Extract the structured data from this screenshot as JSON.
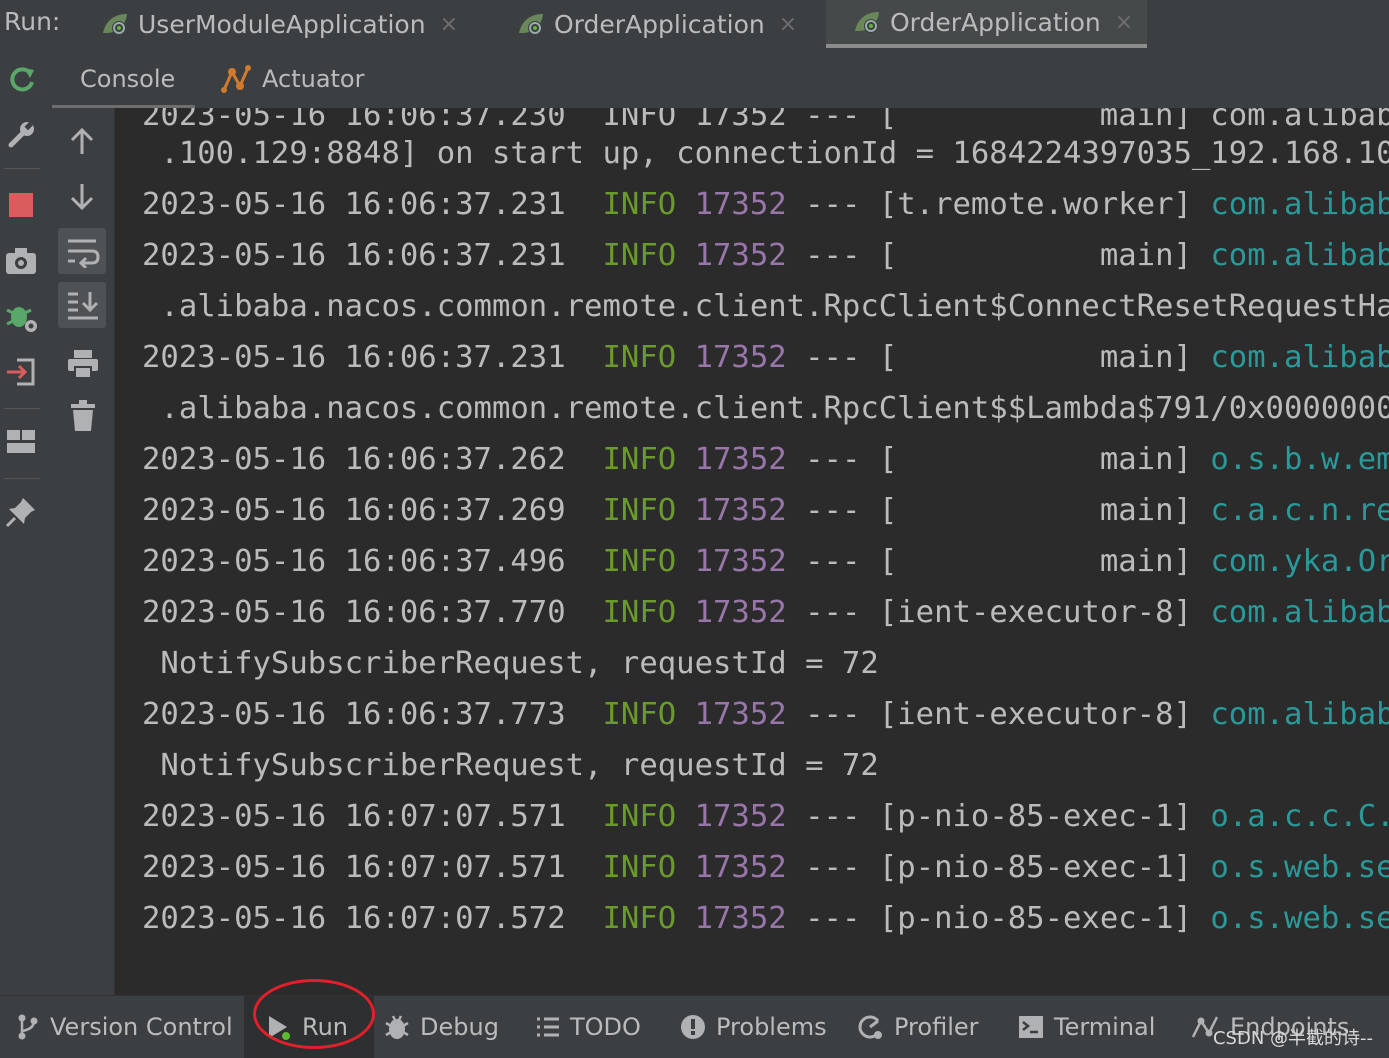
{
  "run_bar": {
    "label": "Run:",
    "tabs": [
      {
        "label": "UserModuleApplication",
        "close": "×"
      },
      {
        "label": "OrderApplication",
        "close": "×"
      },
      {
        "label": "OrderApplication",
        "close": "×"
      }
    ]
  },
  "sub_tabs": {
    "console": "Console",
    "actuator": "Actuator"
  },
  "console": {
    "lines": [
      {
        "type": "cont",
        "text": "2023-05-16 16:06:37.230  INFO 17352 --- [           main] com.alibab"
      },
      {
        "type": "cont",
        "text": " .100.129:8848] on start up, connectionId = 1684224397035_192.168.10"
      },
      {
        "type": "log",
        "ts": "2023-05-16 16:06:37.231",
        "level": "INFO",
        "pid": "17352",
        "sep": "---",
        "thread": "[t.remote.worker]",
        "logger": "com.alibab"
      },
      {
        "type": "log",
        "ts": "2023-05-16 16:06:37.231",
        "level": "INFO",
        "pid": "17352",
        "sep": "---",
        "thread": "[           main]",
        "logger": "com.alibab"
      },
      {
        "type": "cont",
        "text": " .alibaba.nacos.common.remote.client.RpcClient$ConnectResetRequestHa"
      },
      {
        "type": "log",
        "ts": "2023-05-16 16:06:37.231",
        "level": "INFO",
        "pid": "17352",
        "sep": "---",
        "thread": "[           main]",
        "logger": "com.alibab"
      },
      {
        "type": "cont",
        "text": " .alibaba.nacos.common.remote.client.RpcClient$$Lambda$791/0x0000000"
      },
      {
        "type": "log",
        "ts": "2023-05-16 16:06:37.262",
        "level": "INFO",
        "pid": "17352",
        "sep": "---",
        "thread": "[           main]",
        "logger": "o.s.b.w.em"
      },
      {
        "type": "log",
        "ts": "2023-05-16 16:06:37.269",
        "level": "INFO",
        "pid": "17352",
        "sep": "---",
        "thread": "[           main]",
        "logger": "c.a.c.n.re"
      },
      {
        "type": "log",
        "ts": "2023-05-16 16:06:37.496",
        "level": "INFO",
        "pid": "17352",
        "sep": "---",
        "thread": "[           main]",
        "logger": "com.yka.Or"
      },
      {
        "type": "log",
        "ts": "2023-05-16 16:06:37.770",
        "level": "INFO",
        "pid": "17352",
        "sep": "---",
        "thread": "[ient-executor-8]",
        "logger": "com.alibab"
      },
      {
        "type": "cont",
        "text": " NotifySubscriberRequest, requestId = 72"
      },
      {
        "type": "log",
        "ts": "2023-05-16 16:06:37.773",
        "level": "INFO",
        "pid": "17352",
        "sep": "---",
        "thread": "[ient-executor-8]",
        "logger": "com.alibab"
      },
      {
        "type": "cont",
        "text": " NotifySubscriberRequest, requestId = 72"
      },
      {
        "type": "log",
        "ts": "2023-05-16 16:07:07.571",
        "level": "INFO",
        "pid": "17352",
        "sep": "---",
        "thread": "[p-nio-85-exec-1]",
        "logger": "o.a.c.c.C."
      },
      {
        "type": "log",
        "ts": "2023-05-16 16:07:07.571",
        "level": "INFO",
        "pid": "17352",
        "sep": "---",
        "thread": "[p-nio-85-exec-1]",
        "logger": "o.s.web.se"
      },
      {
        "type": "log",
        "ts": "2023-05-16 16:07:07.572",
        "level": "INFO",
        "pid": "17352",
        "sep": "---",
        "thread": "[p-nio-85-exec-1]",
        "logger": "o.s.web.se"
      }
    ]
  },
  "bottom_bar": {
    "items": [
      {
        "label": "Version Control",
        "icon": "branch-icon"
      },
      {
        "label": "Run",
        "icon": "play-icon"
      },
      {
        "label": "Debug",
        "icon": "bug-icon"
      },
      {
        "label": "TODO",
        "icon": "list-icon"
      },
      {
        "label": "Problems",
        "icon": "alert-icon"
      },
      {
        "label": "Profiler",
        "icon": "profiler-icon"
      },
      {
        "label": "Terminal",
        "icon": "terminal-icon"
      },
      {
        "label": "Endpoints",
        "icon": "endpoints-icon"
      }
    ],
    "watermark": "CSDN @半截的诗--"
  },
  "colors": {
    "info": "#6a9a2c",
    "pid": "#9876aa",
    "logger": "#299999",
    "highlight_red": "#e0202a"
  }
}
